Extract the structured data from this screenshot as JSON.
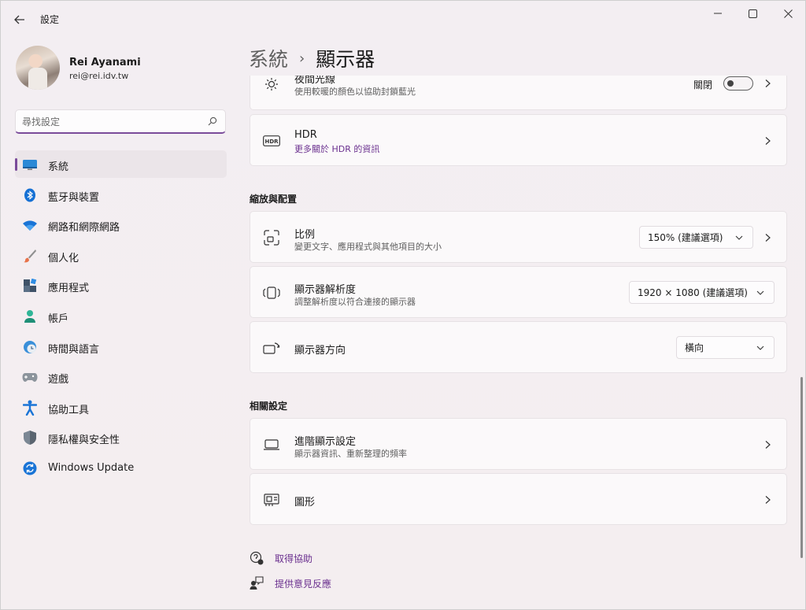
{
  "window": {
    "title": "設定"
  },
  "profile": {
    "name": "Rei Ayanami",
    "email": "rei@rei.idv.tw"
  },
  "search": {
    "placeholder": "尋找設定"
  },
  "sidebar": {
    "items": [
      {
        "label": "系統",
        "icon": "system-monitor-icon",
        "active": true
      },
      {
        "label": "藍牙與裝置",
        "icon": "bluetooth-icon"
      },
      {
        "label": "網路和網際網路",
        "icon": "wifi-icon"
      },
      {
        "label": "個人化",
        "icon": "brush-icon"
      },
      {
        "label": "應用程式",
        "icon": "apps-icon"
      },
      {
        "label": "帳戶",
        "icon": "account-icon"
      },
      {
        "label": "時間與語言",
        "icon": "clock-globe-icon"
      },
      {
        "label": "遊戲",
        "icon": "gamepad-icon"
      },
      {
        "label": "協助工具",
        "icon": "accessibility-icon"
      },
      {
        "label": "隱私權與安全性",
        "icon": "shield-icon"
      },
      {
        "label": "Windows Update",
        "icon": "update-icon"
      }
    ]
  },
  "breadcrumb": {
    "parent": "系統",
    "separator": "›",
    "current": "顯示器"
  },
  "night_light": {
    "title": "夜間光線",
    "subtitle": "使用較暖的顏色以協助封鎖藍光",
    "state_label": "關閉"
  },
  "hdr": {
    "title": "HDR",
    "link": "更多關於 HDR 的資訊"
  },
  "sections": {
    "scale_layout": "縮放與配置",
    "related": "相關設定"
  },
  "scale": {
    "title": "比例",
    "subtitle": "變更文字、應用程式與其他項目的大小",
    "value": "150% (建議選項)"
  },
  "resolution": {
    "title": "顯示器解析度",
    "subtitle": "調整解析度以符合連接的顯示器",
    "value": "1920 × 1080 (建議選項)"
  },
  "orientation": {
    "title": "顯示器方向",
    "value": "橫向"
  },
  "advanced": {
    "title": "進階顯示設定",
    "subtitle": "顯示器資訊、重新整理的頻率"
  },
  "graphics": {
    "title": "圖形"
  },
  "footer": {
    "help": "取得協助",
    "feedback": "提供意見反應"
  },
  "colors": {
    "accent": "#7a4b9a",
    "link": "#6a2f8e"
  }
}
